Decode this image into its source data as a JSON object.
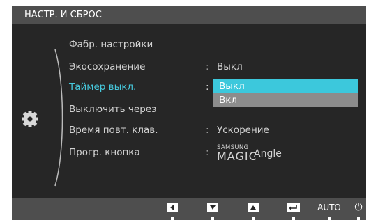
{
  "header": {
    "title": "НАСТР. И СБРОС"
  },
  "menu": {
    "items": [
      {
        "label": "Фабр. настройки",
        "value": "",
        "has_colon": false
      },
      {
        "label": "Экосохранение",
        "value": "Выкл",
        "has_colon": true
      },
      {
        "label": "Таймер выкл.",
        "value": "",
        "has_colon": true,
        "selected": true
      },
      {
        "label": "Выключить через",
        "value": "",
        "has_colon": false
      },
      {
        "label": "Время повт. клав.",
        "value": "Ускорение",
        "has_colon": true
      },
      {
        "label": "Прогр. кнопка",
        "value": "",
        "has_colon": true
      }
    ],
    "magic_angle": {
      "brand_small": "SAMSUNG",
      "brand_big": "MAGIC",
      "suffix": "Angle"
    }
  },
  "dropdown": {
    "options": [
      "Выкл",
      "Вкл"
    ],
    "selected_index": 0
  },
  "bottom_bar": {
    "buttons": [
      {
        "icon": "left-arrow-icon"
      },
      {
        "icon": "down-arrow-icon"
      },
      {
        "icon": "up-arrow-icon"
      },
      {
        "icon": "enter-icon"
      },
      {
        "label": "AUTO"
      },
      {
        "icon": "power-icon",
        "glyph": "⏻"
      }
    ]
  },
  "colors": {
    "osd_background": "#262626",
    "title_bar": "#4e4e4e",
    "accent": "#3cc8dc",
    "dropdown_background": "#8c8c8c"
  }
}
